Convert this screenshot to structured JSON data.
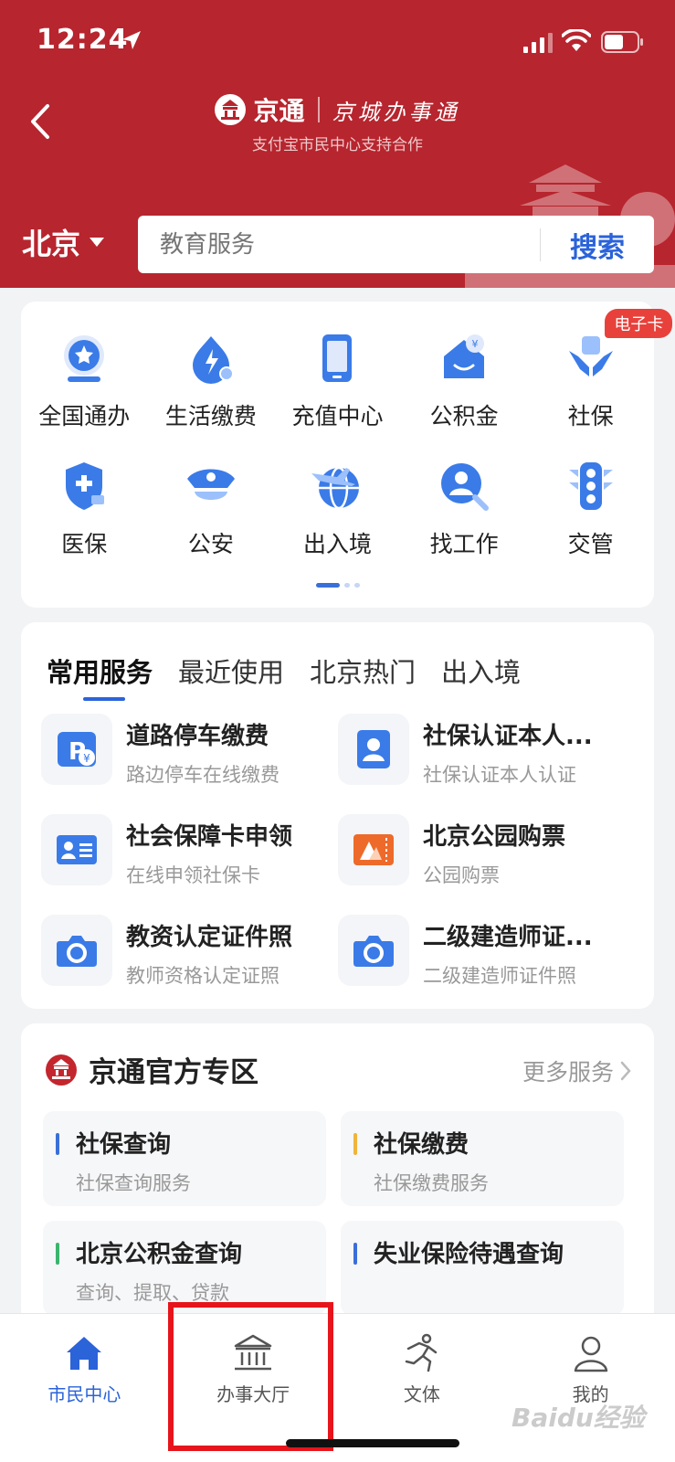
{
  "status_bar": {
    "time": "12:24"
  },
  "header": {
    "brand": "京通",
    "slogan": "京城办事通",
    "subtitle": "支付宝市民中心支持合作",
    "badge_text": "京通"
  },
  "city": "北京",
  "search": {
    "placeholder": "教育服务",
    "button": "搜索"
  },
  "grid": {
    "items": [
      {
        "label": "全国通办",
        "icon": "globe-sphere-icon"
      },
      {
        "label": "生活缴费",
        "icon": "lightning-bill-icon"
      },
      {
        "label": "充值中心",
        "icon": "phone-recharge-icon"
      },
      {
        "label": "公积金",
        "icon": "housing-fund-icon"
      },
      {
        "label": "社保",
        "icon": "social-security-hands-icon",
        "badge": "电子卡"
      },
      {
        "label": "医保",
        "icon": "medical-shield-icon"
      },
      {
        "label": "公安",
        "icon": "police-cap-icon"
      },
      {
        "label": "出入境",
        "icon": "plane-globe-icon"
      },
      {
        "label": "找工作",
        "icon": "job-search-icon"
      },
      {
        "label": "交管",
        "icon": "traffic-light-icon"
      }
    ]
  },
  "service_tabs": [
    "常用服务",
    "最近使用",
    "北京热门",
    "出入境"
  ],
  "services": [
    {
      "title": "道路停车缴费",
      "sub": "路边停车在线缴费",
      "icon": "parking-icon"
    },
    {
      "title": "社保认证本人...",
      "sub": "社保认证本人认证",
      "icon": "person-card-icon"
    },
    {
      "title": "社会保障卡申领",
      "sub": "在线申领社保卡",
      "icon": "id-card-icon"
    },
    {
      "title": "北京公园购票",
      "sub": "公园购票",
      "icon": "ticket-icon"
    },
    {
      "title": "教资认定证件照",
      "sub": "教师资格认定证照",
      "icon": "camera-icon"
    },
    {
      "title": "二级建造师证...",
      "sub": "二级建造师证件照",
      "icon": "camera-icon"
    }
  ],
  "official": {
    "title": "京通官方专区",
    "more": "更多服务",
    "items": [
      {
        "title": "社保查询",
        "sub": "社保查询服务",
        "color": "#3a6fd8"
      },
      {
        "title": "社保缴费",
        "sub": "社保缴费服务",
        "color": "#f0b33b"
      },
      {
        "title": "北京公积金查询",
        "sub": "查询、提取、贷款",
        "color": "#3bb56c"
      },
      {
        "title": "失业保险待遇查询",
        "sub": "",
        "color": "#3a6fd8"
      }
    ]
  },
  "tabbar": [
    {
      "label": "市民中心",
      "icon": "home-icon",
      "active": true
    },
    {
      "label": "办事大厅",
      "icon": "government-hall-icon",
      "active": false
    },
    {
      "label": "文体",
      "icon": "runner-icon",
      "active": false
    },
    {
      "label": "我的",
      "icon": "user-profile-icon",
      "active": false
    }
  ],
  "watermark": "Baidu经验",
  "colors": {
    "header_red": "#b7252e",
    "accent_blue": "#2b63d9",
    "highlight_red": "#e8141b"
  }
}
